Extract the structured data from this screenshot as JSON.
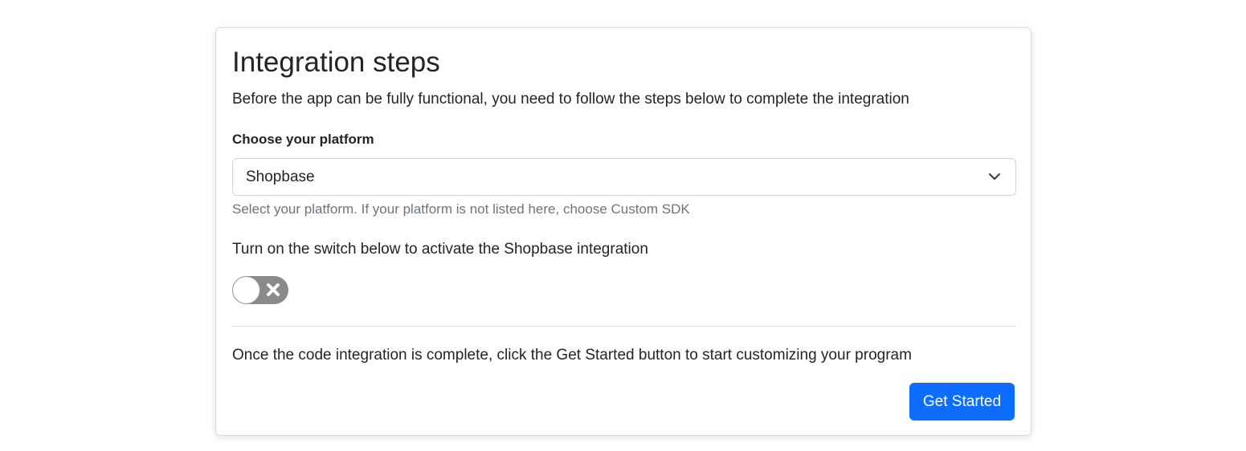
{
  "card": {
    "title": "Integration steps",
    "intro": "Before the app can be fully functional, you need to follow the steps below to complete the integration"
  },
  "platform": {
    "label": "Choose your platform",
    "selected": "Shopbase",
    "help": "Select your platform. If your platform is not listed here, choose Custom SDK"
  },
  "integration_switch": {
    "text": "Turn on the switch below to activate the Shopbase integration",
    "state": "off",
    "icon": "x-icon"
  },
  "footer": {
    "text": "Once the code integration is complete, click the Get Started button to start customizing your program",
    "button_label": "Get Started"
  },
  "colors": {
    "primary": "#0d6efd",
    "toggle_off": "#8a8a8a",
    "muted_text": "#6c757d"
  }
}
